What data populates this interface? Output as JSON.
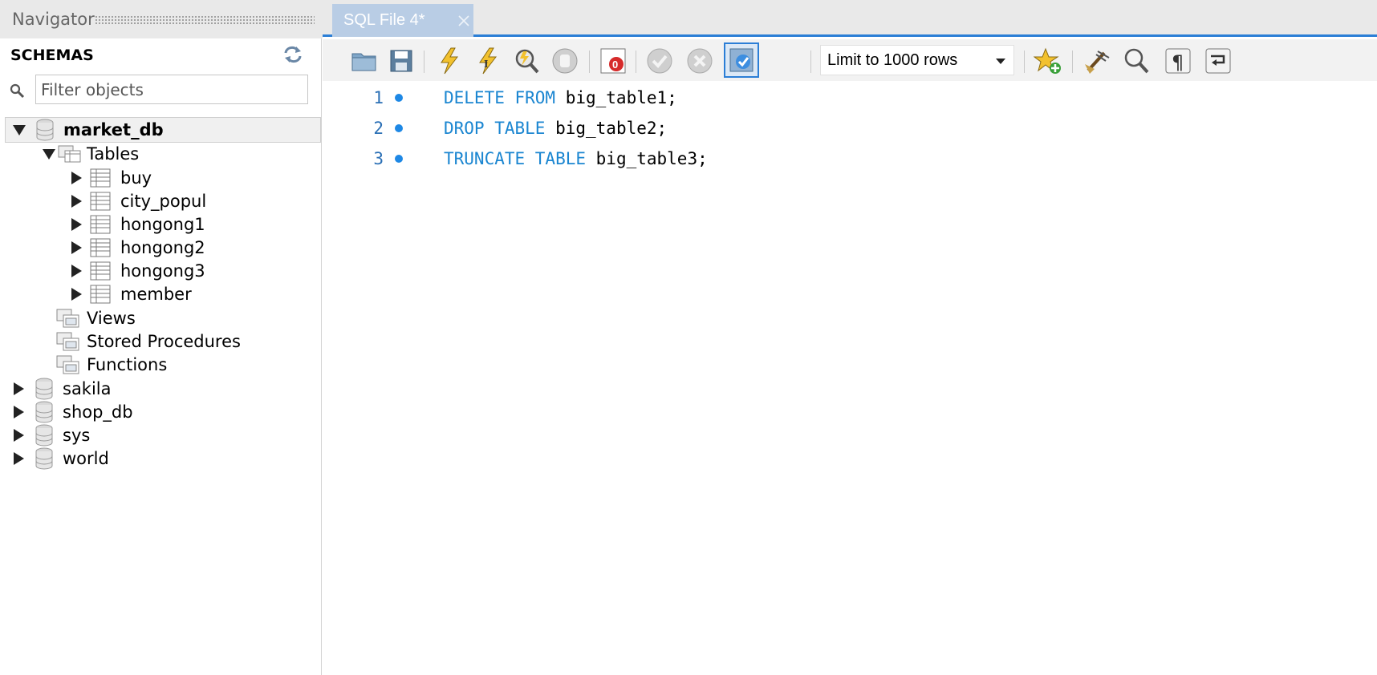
{
  "navigator": {
    "title": "Navigator",
    "schemas_label": "SCHEMAS",
    "filter_placeholder": "Filter objects",
    "tree": {
      "market_db": "market_db",
      "tables": "Tables",
      "table_items": [
        "buy",
        "city_popul",
        "hongong1",
        "hongong2",
        "hongong3",
        "member"
      ],
      "views": "Views",
      "stored_procedures": "Stored Procedures",
      "functions": "Functions",
      "other_schemas": [
        "sakila",
        "shop_db",
        "sys",
        "world"
      ]
    }
  },
  "editor": {
    "tab_label": "SQL File 4*",
    "limit_label": "Limit to 1000 rows",
    "lines": [
      {
        "num": "1",
        "kw": "DELETE FROM",
        "rest": " big_table1;"
      },
      {
        "num": "2",
        "kw": "DROP TABLE",
        "rest": " big_table2;"
      },
      {
        "num": "3",
        "kw": "TRUNCATE TABLE",
        "rest": " big_table3;"
      }
    ]
  },
  "icons": {
    "toolbar": [
      "open-folder-icon",
      "save-icon",
      "execute-icon",
      "execute-current-icon",
      "explain-icon",
      "stop-icon",
      "toggle-continue-icon",
      "commit-icon",
      "rollback-icon",
      "autocommit-icon",
      "add-snippet-icon",
      "beautify-icon",
      "find-icon",
      "invisible-chars-icon",
      "wrap-lines-icon"
    ]
  },
  "colors": {
    "keyword": "#1b86d1",
    "accent": "#2b7ed6",
    "tab_bg": "#b9cde5"
  }
}
